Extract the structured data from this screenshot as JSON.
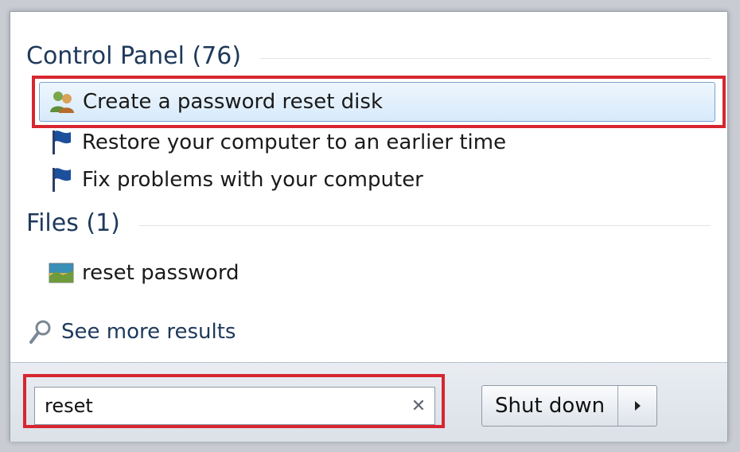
{
  "control_panel": {
    "header": "Control Panel (76)",
    "items": [
      {
        "label": "Create a password reset disk",
        "icon": "users-icon"
      },
      {
        "label": "Restore your computer to an earlier time",
        "icon": "flag-icon"
      },
      {
        "label": "Fix problems with your computer",
        "icon": "flag-icon"
      }
    ]
  },
  "files": {
    "header": "Files (1)",
    "items": [
      {
        "label": "reset password",
        "icon": "image-file-icon"
      }
    ]
  },
  "see_more": {
    "label": "See more results",
    "icon": "search-icon"
  },
  "search": {
    "value": "reset",
    "clear_icon": "close-icon"
  },
  "shutdown": {
    "label": "Shut down",
    "arrow_icon": "chevron-right-icon"
  },
  "colors": {
    "header_text": "#1e395b",
    "highlight": "#d7262f",
    "selection_border": "#7da2ce",
    "flag_blue": "#1c4f9c"
  }
}
